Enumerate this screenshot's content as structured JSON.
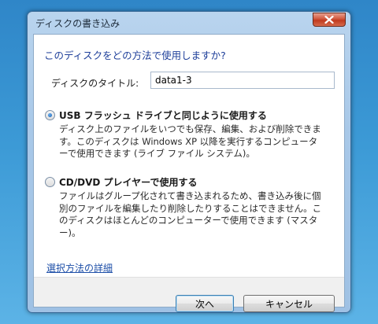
{
  "window": {
    "title": "ディスクの書き込み"
  },
  "dialog": {
    "heading": "このディスクをどの方法で使用しますか?",
    "title_label": "ディスクのタイトル:",
    "title_value": "data1-3",
    "options": [
      {
        "title": "USB フラッシュ ドライブと同じように使用する",
        "lines": [
          "ディスク上のファイルをいつでも保存、編集、および削除できま",
          "す。このディスクは Windows XP 以降を実行するコンピュータ",
          "ーで使用できます (ライブ ファイル システム)。"
        ],
        "selected": true
      },
      {
        "title": "CD/DVD プレイヤーで使用する",
        "lines": [
          "ファイルはグループ化されて書き込まれるため、書き込み後に個",
          "別のファイルを編集したり削除したりすることはできません。こ",
          "のディスクはほとんどのコンピューターで使用できます (マスタ",
          "ー)。"
        ],
        "selected": false
      }
    ],
    "details_link": "選択方法の詳細",
    "next_label": "次へ",
    "cancel_label": "キャンセル"
  },
  "colors": {
    "heading": "#1e3f9a",
    "link": "#1e4fa8",
    "close_button": "#c8462a"
  },
  "icons": {
    "close": "close-icon"
  }
}
